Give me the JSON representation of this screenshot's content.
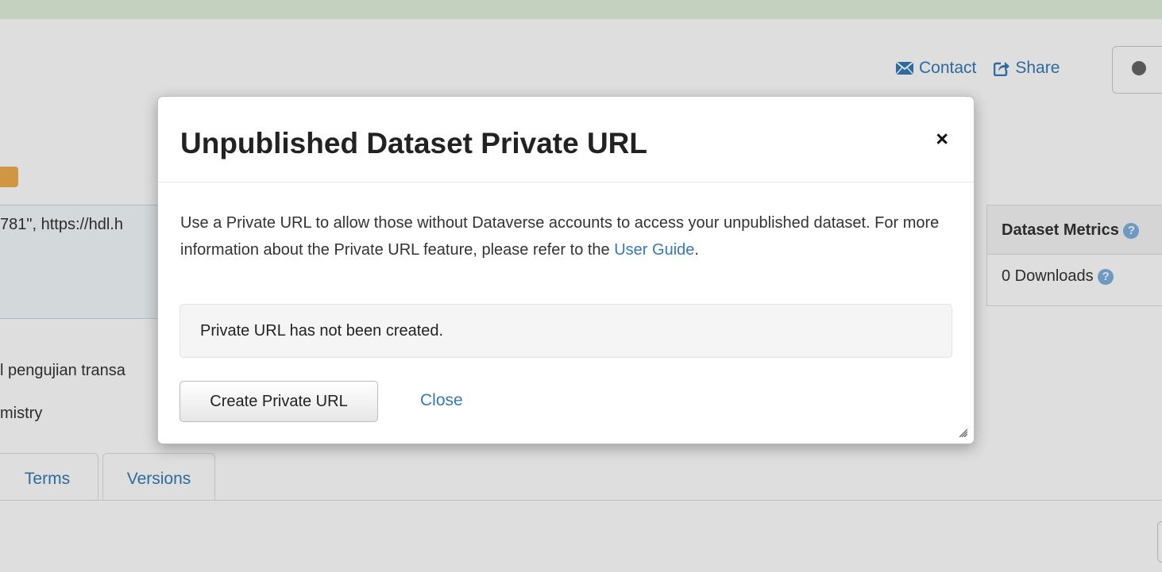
{
  "header": {
    "contact_label": "Contact",
    "share_label": "Share",
    "icons": {
      "contact": "envelope-icon",
      "share": "share-icon",
      "access": "globe-icon"
    }
  },
  "dataset": {
    "citation_fragment": "781\", https://hdl.h",
    "description_fragment": "l pengujian transa",
    "subject_fragment": "mistry"
  },
  "metrics": {
    "heading": "Dataset Metrics",
    "downloads": "0 Downloads"
  },
  "tabs": [
    {
      "label": "Terms"
    },
    {
      "label": "Versions"
    }
  ],
  "modal": {
    "title": "Unpublished Dataset Private URL",
    "close_symbol": "×",
    "description_prefix": "Use a Private URL to allow those without Dataverse accounts to access your unpublished dataset. For more information about the Private URL feature, please refer to the ",
    "user_guide_link": "User Guide",
    "description_suffix": ".",
    "status_message": "Private URL has not been created.",
    "create_button": "Create Private URL",
    "close_link": "Close"
  },
  "colors": {
    "link": "#337ab7",
    "topbar": "#e3f0dc",
    "warning": "#f0ad4e",
    "help_icon": "#7fb0e0"
  }
}
